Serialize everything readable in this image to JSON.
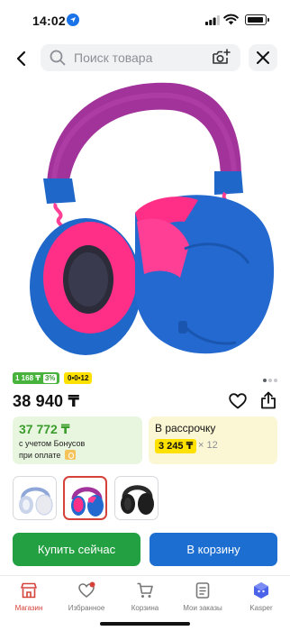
{
  "status_bar": {
    "time": "14:02"
  },
  "search": {
    "placeholder": "Поиск товара"
  },
  "badges": {
    "bonus_amount": "1 168 ₸",
    "bonus_percent": "3%",
    "installment_code": "0•0•12"
  },
  "product": {
    "price": "38 940 ₸"
  },
  "bonus_card": {
    "price": "37 772 ₸",
    "line1": "с учетом Бонусов",
    "line2": "при оплате"
  },
  "installment_card": {
    "title": "В рассрочку",
    "monthly": "3 245 ₸",
    "multiplier": "× 12"
  },
  "variants": [
    {
      "color_name": "white",
      "color": "#e8eaf0",
      "selected": false
    },
    {
      "color_name": "blue-pink",
      "color": "#2369cf",
      "selected": true
    },
    {
      "color_name": "black",
      "color": "#1e1e1e",
      "selected": false
    }
  ],
  "actions": {
    "buy_now": "Купить сейчас",
    "add_to_cart": "В корзину"
  },
  "tabs": [
    {
      "label": "Магазин",
      "icon": "shop-icon",
      "active": true
    },
    {
      "label": "Избранное",
      "icon": "heart-icon",
      "active": false
    },
    {
      "label": "Корзина",
      "icon": "cart-icon",
      "active": false
    },
    {
      "label": "Мои заказы",
      "icon": "orders-icon",
      "active": false
    },
    {
      "label": "Kasper",
      "icon": "kasper-icon",
      "active": false
    }
  ],
  "colors": {
    "accent_red": "#d5423a",
    "buy_green": "#23a042",
    "cart_blue": "#1c6fd1",
    "bonus_green": "#47b33d",
    "installment_yellow": "#ffe100"
  }
}
